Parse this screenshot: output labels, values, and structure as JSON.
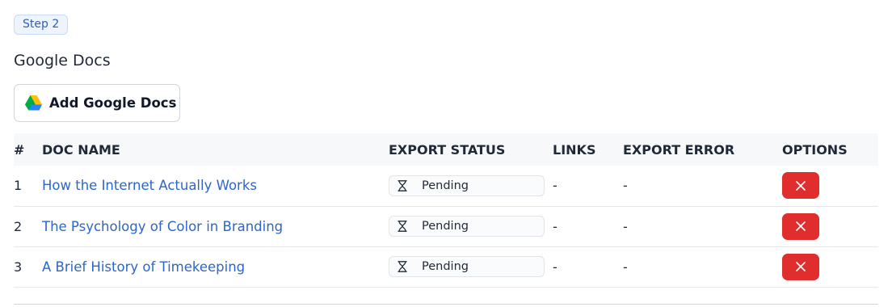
{
  "step": {
    "label": "Step 2"
  },
  "section": {
    "title": "Google Docs"
  },
  "add_button": {
    "label": "Add Google Docs",
    "icon": "google-drive-icon"
  },
  "table": {
    "headers": {
      "num": "#",
      "doc_name": "DOC NAME",
      "export_status": "EXPORT STATUS",
      "links": "LINKS",
      "export_error": "EXPORT ERROR",
      "options": "OPTIONS"
    },
    "rows": [
      {
        "num": "1",
        "doc_name": "How the Internet Actually Works",
        "status": "Pending",
        "links": "-",
        "error": "-"
      },
      {
        "num": "2",
        "doc_name": "The Psychology of Color in Branding",
        "status": "Pending",
        "links": "-",
        "error": "-"
      },
      {
        "num": "3",
        "doc_name": "A Brief History of Timekeeping",
        "status": "Pending",
        "links": "-",
        "error": "-"
      }
    ]
  },
  "colors": {
    "link": "#2e66c8",
    "delete_button": "#e02d2d",
    "badge_bg": "#eef4fd",
    "badge_text": "#2f5fad"
  }
}
